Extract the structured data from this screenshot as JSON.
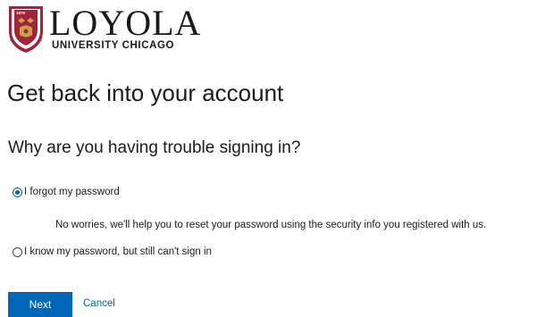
{
  "brand": {
    "name": "LOYOLA",
    "sub": "UNIVERSITY CHICAGO",
    "seal_year": "1870",
    "seal_motto": "AD MAJOREM DEI GLORIAM",
    "crest_color": "#a0253a",
    "gold_color": "#c9a24a"
  },
  "page": {
    "title": "Get back into your account",
    "subtitle": "Why are you having trouble signing in?"
  },
  "options": [
    {
      "label": "I forgot my password",
      "checked": true,
      "description": "No worries, we'll help you to reset your password using the security info you registered with us."
    },
    {
      "label": "I know my password, but still can't sign in",
      "checked": false
    }
  ],
  "actions": {
    "next_label": "Next",
    "cancel_label": "Cancel",
    "accent": "#0067b8"
  }
}
